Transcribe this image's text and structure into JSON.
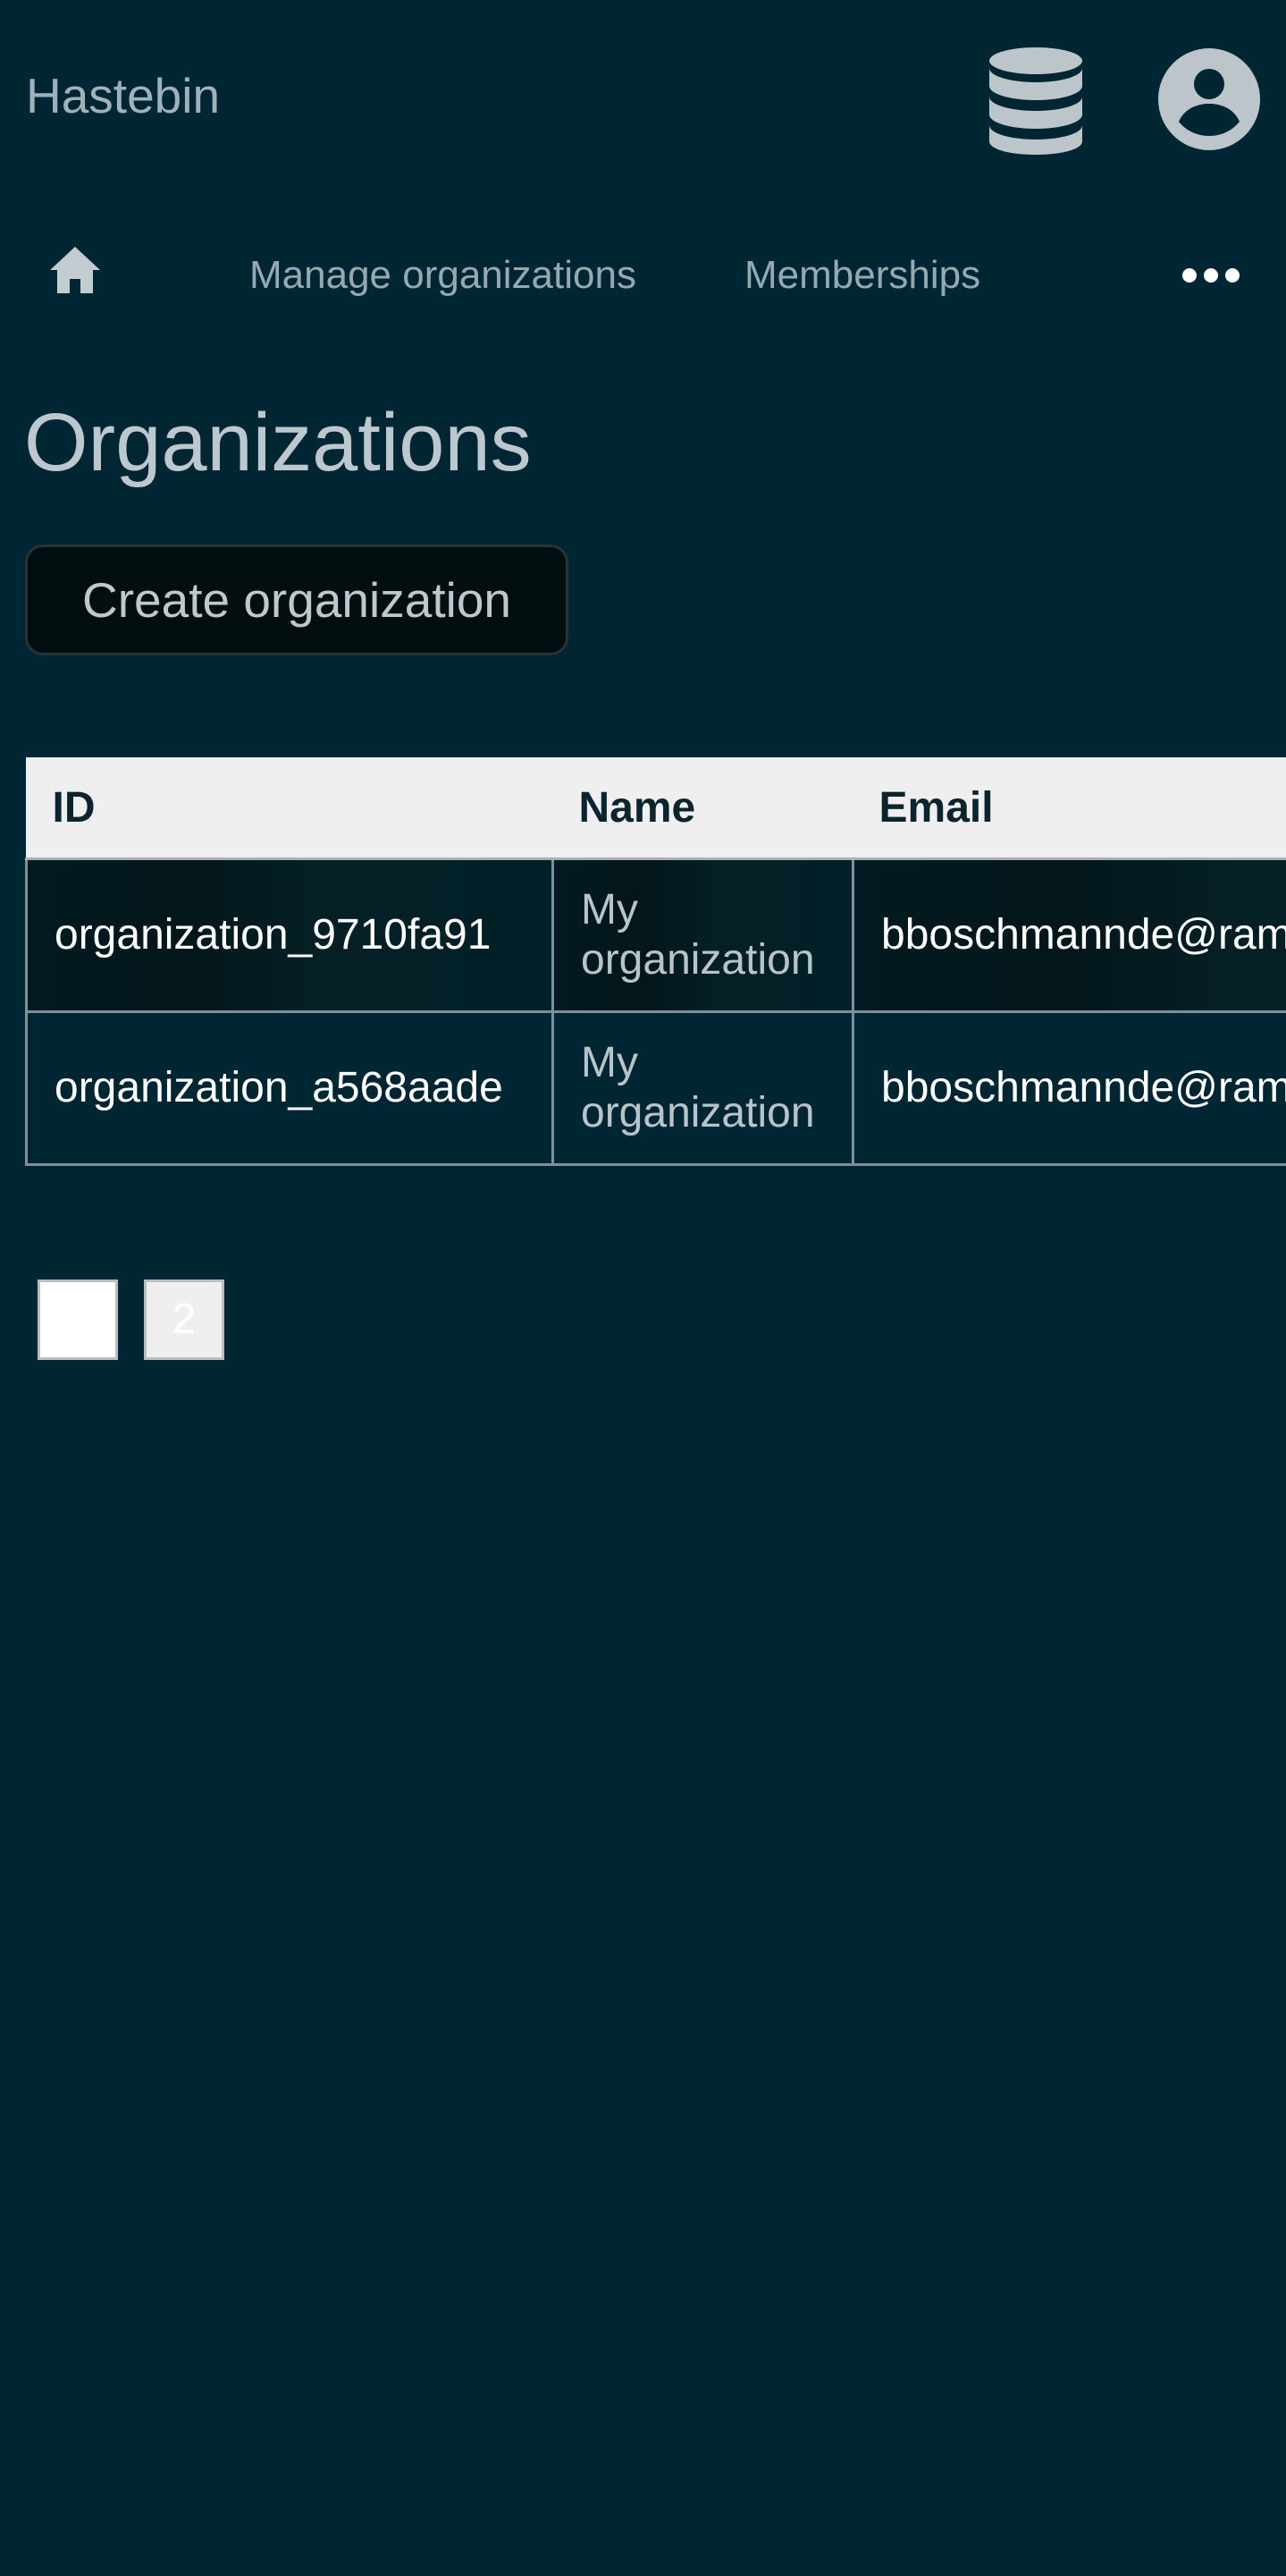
{
  "header": {
    "app_name": "Hastebin"
  },
  "nav": {
    "home_icon": "home-icon",
    "links": [
      {
        "label": "Manage organizations"
      },
      {
        "label": "Memberships"
      }
    ],
    "more_icon": "more-horizontal-icon"
  },
  "main": {
    "title": "Organizations",
    "create_label": "Create organization"
  },
  "table": {
    "columns": [
      "ID",
      "Name",
      "Email"
    ],
    "rows": [
      {
        "id": "organization_9710fa91",
        "name": "My organization",
        "email": "bboschmannde@ram"
      },
      {
        "id": "organization_a568aade",
        "name": "My organization",
        "email": "bboschmannde@ram"
      }
    ]
  },
  "pagination": {
    "current": "",
    "next": "2"
  },
  "colors": {
    "background": "#002633",
    "header_row": "#efefef",
    "button_bg": "#030e11"
  }
}
